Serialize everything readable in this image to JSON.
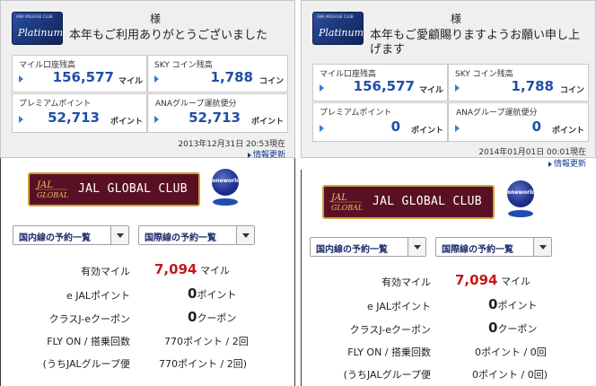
{
  "left": {
    "card": {
      "small_text": "ANA MILEAGE CLUB",
      "name": "Platinum"
    },
    "sama": "様",
    "greeting": "本年もご利用ありがとうございました",
    "miles_label": "マイル口座残高",
    "miles_value": "156,577",
    "miles_unit": "マイル",
    "sky_label": "SKY コイン残高",
    "sky_value": "1,788",
    "sky_unit": "コイン",
    "premium_label": "プレミアムポイント",
    "premium_value": "52,713",
    "premium_unit": "ポイント",
    "group_label": "ANAグループ運航便分",
    "group_value": "52,713",
    "group_unit": "ポイント",
    "timestamp": "2013年12月31日 20:53現在",
    "refresh": "情報更新",
    "jal": {
      "club": "JAL GLOBAL CLUB",
      "oneworld": "oneworld",
      "domestic": "国内線の予約一覧",
      "international": "国際線の予約一覧",
      "rows": [
        {
          "label": "有効マイル",
          "num": "7,094",
          "unit": "マイル"
        },
        {
          "label": "e JALポイント",
          "num": "0",
          "unit": "ポイント"
        },
        {
          "label": "クラスJ-eクーポン",
          "num": "0",
          "unit": "クーポン"
        },
        {
          "label": "FLY ON / 搭乗回数",
          "num": "",
          "unit": "770ポイント / 2回"
        },
        {
          "label": "(うちJALグループ便",
          "num": "",
          "unit": "770ポイント / 2回)"
        }
      ]
    }
  },
  "right": {
    "card": {
      "small_text": "ANA MILEAGE CLUB",
      "name": "Platinum"
    },
    "sama": "様",
    "greeting": "本年もご愛顧賜りますようお願い申し上げます",
    "miles_label": "マイル口座残高",
    "miles_value": "156,577",
    "miles_unit": "マイル",
    "sky_label": "SKY コイン残高",
    "sky_value": "1,788",
    "sky_unit": "コイン",
    "premium_label": "プレミアムポイント",
    "premium_value": "0",
    "premium_unit": "ポイント",
    "group_label": "ANAグループ運航便分",
    "group_value": "0",
    "group_unit": "ポイント",
    "timestamp": "2014年01月01日 00:01現在",
    "refresh": "情報更新",
    "jal": {
      "club": "JAL GLOBAL CLUB",
      "oneworld": "oneworld",
      "domestic": "国内線の予約一覧",
      "international": "国際線の予約一覧",
      "rows": [
        {
          "label": "有効マイル",
          "num": "7,094",
          "unit": "マイル"
        },
        {
          "label": "e JALポイント",
          "num": "0",
          "unit": "ポイント"
        },
        {
          "label": "クラスJ-eクーポン",
          "num": "0",
          "unit": "クーポン"
        },
        {
          "label": "FLY ON / 搭乗回数",
          "num": "",
          "unit": "0ポイント / 0回"
        },
        {
          "label": "(うちJALグループ便",
          "num": "",
          "unit": "0ポイント / 0回)"
        }
      ]
    }
  },
  "colors": {
    "ana_blue": "#1f4fa8",
    "jal_red": "#c8151b",
    "jal_burgundy": "#5a1024",
    "gold": "#c9a43a"
  }
}
